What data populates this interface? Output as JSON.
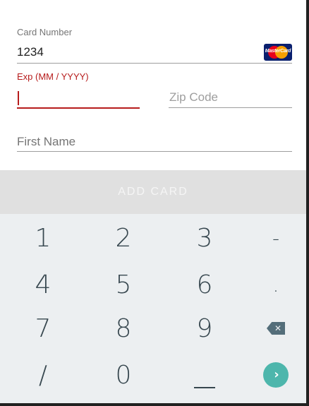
{
  "form": {
    "card_number": {
      "label": "Card Number",
      "value": "1234",
      "brand_logo_text": "MasterCard"
    },
    "expiry": {
      "label": "Exp (MM / YYYY)",
      "value": ""
    },
    "zip": {
      "placeholder": "Zip Code"
    },
    "first_name": {
      "placeholder": "First Name"
    }
  },
  "add_card_button": {
    "label": "ADD CARD"
  },
  "keypad": {
    "rows": [
      [
        "1",
        "2",
        "3",
        "-"
      ],
      [
        "4",
        "5",
        "6",
        "."
      ],
      [
        "7",
        "8",
        "9",
        "backspace-icon"
      ],
      [
        "/",
        "0",
        "_",
        "next-icon"
      ]
    ],
    "backspace_glyph": "✕",
    "next_glyph": "›"
  },
  "colors": {
    "error": "#b71c1c",
    "keypad_background": "#eceff1",
    "button_disabled": "#e0e0e0",
    "accent_next": "#4db6ac"
  }
}
